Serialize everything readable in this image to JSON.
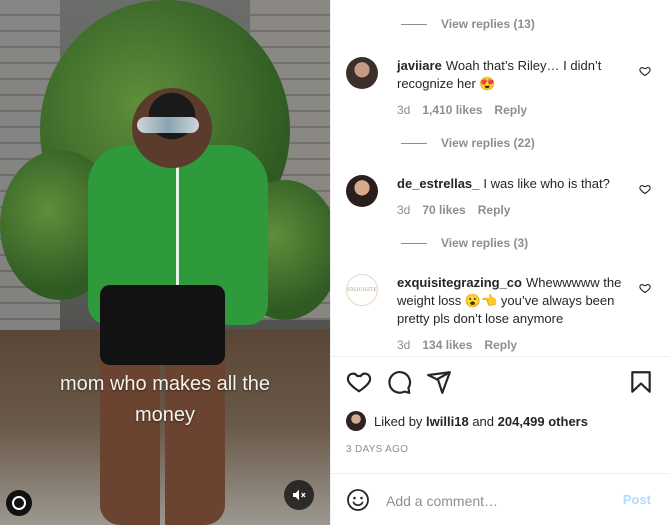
{
  "post": {
    "overlay_line1": "mom who makes all the",
    "overlay_line2": "money"
  },
  "comments": [
    {
      "view_replies": "View replies (13)"
    },
    {
      "username": "javiiare",
      "text": "Woah that’s Riley… I didn’t recognize her 😍",
      "time": "3d",
      "likes": "1,410 likes",
      "reply": "Reply",
      "view_replies": "View replies (22)"
    },
    {
      "username": "de_estrellas_",
      "text": "I was like who is that?",
      "time": "3d",
      "likes": "70 likes",
      "reply": "Reply",
      "view_replies": "View replies (3)"
    },
    {
      "username": "exquisitegrazing_co",
      "avatar_text": "EXQUISITE",
      "text": "Whewwwww the weight loss 😮👈 you’ve always been pretty pls don’t lose anymore",
      "time": "3d",
      "likes": "134 likes",
      "reply": "Reply"
    }
  ],
  "liked_by": {
    "prefix": "Liked by",
    "user": "lwilli18",
    "and": "and",
    "others": "204,499 others"
  },
  "timestamp": "3 DAYS AGO",
  "add_comment": {
    "placeholder": "Add a comment…",
    "post_label": "Post"
  },
  "colors": {
    "link_post_disabled": "#b3dbff",
    "muted_text": "#8e8e8e",
    "text": "#262626"
  },
  "icons": [
    "heart-icon",
    "comment-icon",
    "share-icon",
    "bookmark-icon",
    "emoji-icon",
    "mute-icon"
  ]
}
